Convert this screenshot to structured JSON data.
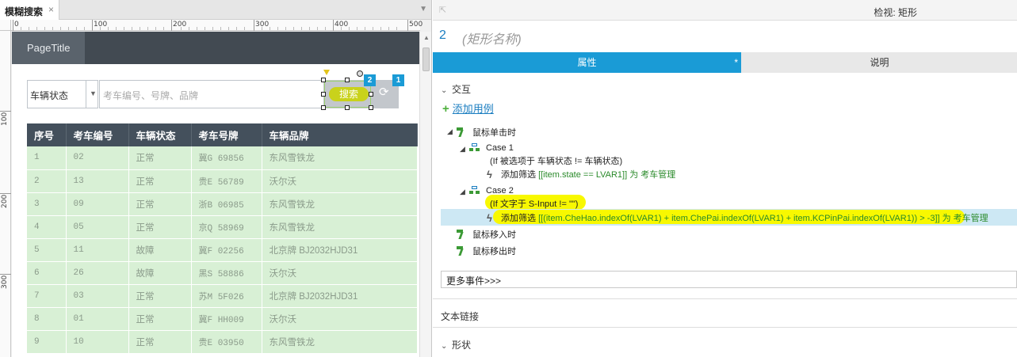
{
  "editor": {
    "tab_label": "模糊搜索",
    "tab_close": "×",
    "ruler_h_labels": [
      "0",
      "100",
      "200",
      "300",
      "400",
      "500"
    ],
    "ruler_v_labels": [
      "100",
      "200",
      "300"
    ]
  },
  "canvas": {
    "page_title": "PageTitle",
    "status_select_value": "车辆状态",
    "search_placeholder": "考车编号、号牌、品牌",
    "search_button_label": "搜索",
    "badge_1": "1",
    "badge_2": "2",
    "table": {
      "headers": [
        "序号",
        "考车编号",
        "车辆状态",
        "考车号牌",
        "车辆品牌"
      ],
      "rows": [
        [
          "1",
          "02",
          "正常",
          "冀G 69856",
          "东风雪铁龙"
        ],
        [
          "2",
          "13",
          "正常",
          "贵E 56789",
          "沃尔沃"
        ],
        [
          "3",
          "09",
          "正常",
          "浙B 06985",
          "东风雪铁龙"
        ],
        [
          "4",
          "05",
          "正常",
          "京Q 58969",
          "东风雪铁龙"
        ],
        [
          "5",
          "11",
          "故障",
          "冀F 02256",
          "北京牌 BJ2032HJD31"
        ],
        [
          "6",
          "26",
          "故障",
          "黑S 58886",
          "沃尔沃"
        ],
        [
          "7",
          "03",
          "正常",
          "苏M 5F026",
          "北京牌 BJ2032HJD31"
        ],
        [
          "8",
          "01",
          "正常",
          "冀F HH009",
          "沃尔沃"
        ],
        [
          "9",
          "10",
          "正常",
          "贵E 03950",
          "东风雪铁龙"
        ]
      ]
    }
  },
  "inspector": {
    "title": "检视: 矩形",
    "shape_number": "2",
    "shape_name_placeholder": "(矩形名称)",
    "tab_properties": "属性",
    "tab_properties_mark": "*",
    "tab_notes": "说明",
    "section_interaction": "交互",
    "add_case": "添加用例",
    "events": {
      "onclick": "鼠标单击时",
      "case1_title": "Case 1",
      "case1_condition": "(If 被选项于 车辆状态 != 车辆状态)",
      "case1_action_prefix": "添加筛选",
      "case1_action_rule": "[[item.state == LVAR1]] 为 考车管理",
      "case2_title": "Case 2",
      "case2_condition": "(If 文字于 S-Input != \"\")",
      "case2_action_prefix": "添加筛选",
      "case2_action_rule": "[[(item.CheHao.indexOf(LVAR1) + item.ChePai.indexOf(LVAR1) + item.KCPinPai.indexOf(LVAR1)) > -3]] 为 考车管理",
      "onmouseenter": "鼠标移入时",
      "onmouseleave": "鼠标移出时"
    },
    "more_events": "更多事件>>>",
    "section_text_link": "文本链接",
    "section_shape": "形状"
  }
}
